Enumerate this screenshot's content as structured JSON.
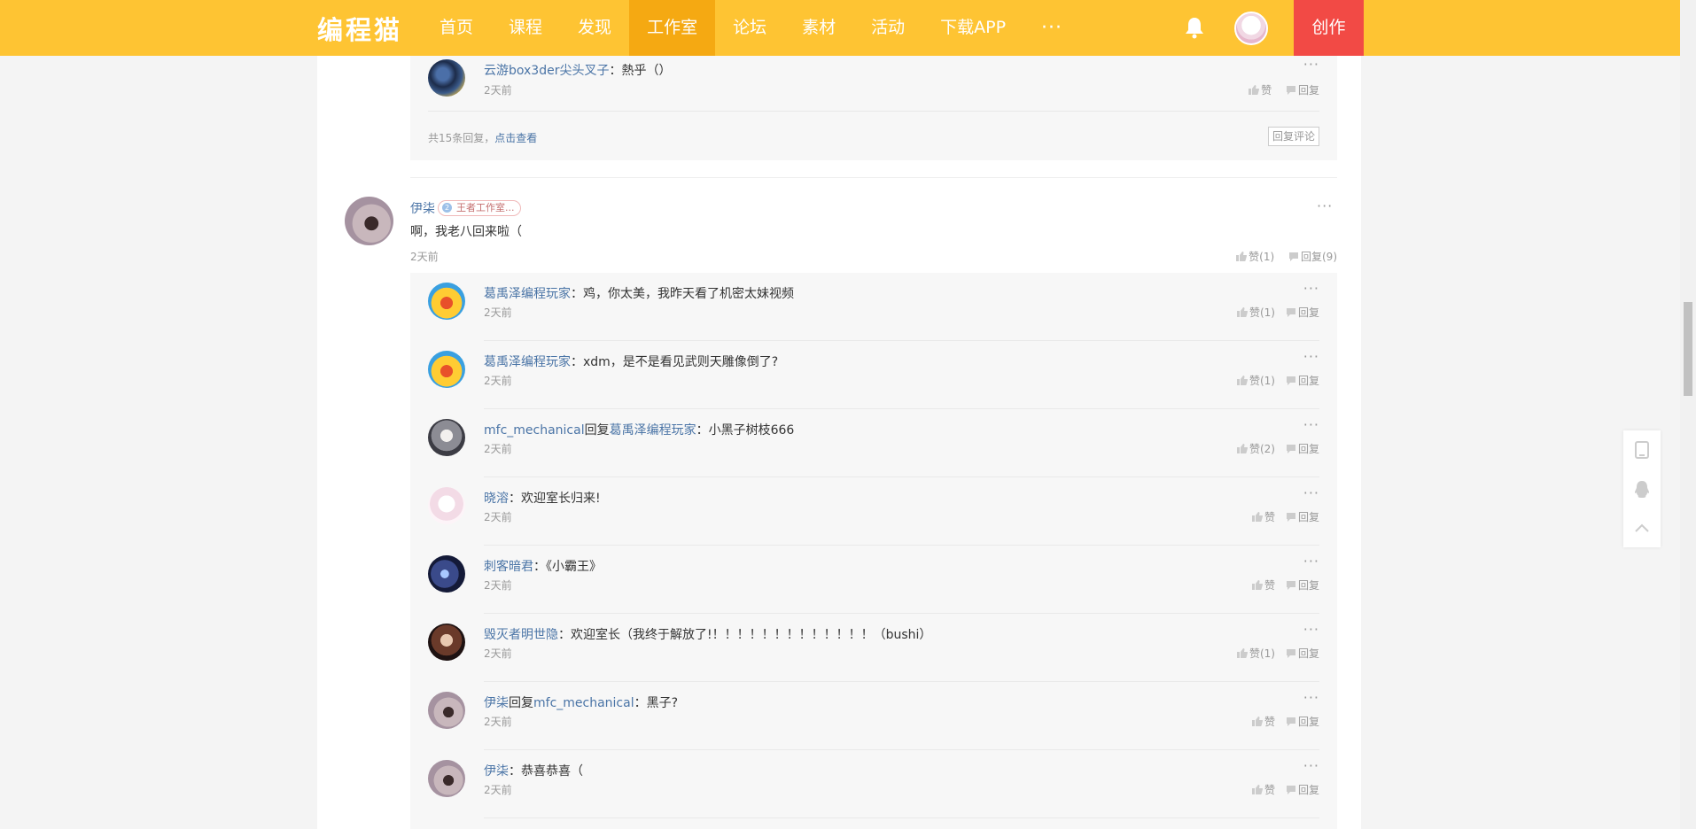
{
  "nav": {
    "logo": "编程猫",
    "items": [
      "首页",
      "课程",
      "发现",
      "工作室",
      "论坛",
      "素材",
      "活动",
      "下载APP"
    ],
    "more": "···",
    "create": "创作"
  },
  "top_box": {
    "reply": {
      "name": "云游box3der尖头叉子",
      "text": "：熱乎（）",
      "time": "2天前",
      "like": "赞",
      "reply": "回复"
    },
    "count_text": "共15条回复，",
    "view_link": "点击查看",
    "reply_comment_button": "回复评论"
  },
  "comment": {
    "name": "伊柒",
    "badge": "王者工作室...",
    "badge_level": "2",
    "text": "啊，我老八回来啦（",
    "time": "2天前",
    "like": "赞(1)",
    "reply": "回复(9)"
  },
  "replies": [
    {
      "name": "葛禹泽编程玩家",
      "mid": "",
      "target": "",
      "text": "：鸡，你太美，我昨天看了机密太妹视频",
      "time": "2天前",
      "like": "赞(1)",
      "reply": "回复"
    },
    {
      "name": "葛禹泽编程玩家",
      "mid": "",
      "target": "",
      "text": "：xdm，是不是看见武则天雕像倒了?",
      "time": "2天前",
      "like": "赞(1)",
      "reply": "回复"
    },
    {
      "name": "mfc_mechanical",
      "mid": "回复",
      "target": "葛禹泽编程玩家",
      "text": "：小黑子树枝666",
      "time": "2天前",
      "like": "赞(2)",
      "reply": "回复"
    },
    {
      "name": "晓溶",
      "mid": "",
      "target": "",
      "text": "：欢迎室长归来!",
      "time": "2天前",
      "like": "赞",
      "reply": "回复"
    },
    {
      "name": "刺客暗君",
      "mid": "",
      "target": "",
      "text": "：《小霸王》",
      "time": "2天前",
      "like": "赞",
      "reply": "回复"
    },
    {
      "name": "毁灭者明世隐",
      "mid": "",
      "target": "",
      "text": "：欢迎室长（我终于解放了!！！！！！！！！！！！！！（bushi）",
      "time": "2天前",
      "like": "赞(1)",
      "reply": "回复"
    },
    {
      "name": "伊柒",
      "mid": "回复",
      "target": "mfc_mechanical",
      "text": "：黑子?",
      "time": "2天前",
      "like": "赞",
      "reply": "回复"
    },
    {
      "name": "伊柒",
      "mid": "",
      "target": "",
      "text": "：恭喜恭喜（",
      "time": "2天前",
      "like": "赞",
      "reply": "回复"
    }
  ],
  "colors": {
    "nav_bg": "#fec433",
    "nav_active": "#f5a912",
    "create_bg": "#f24a45",
    "link": "#4a74a6"
  }
}
